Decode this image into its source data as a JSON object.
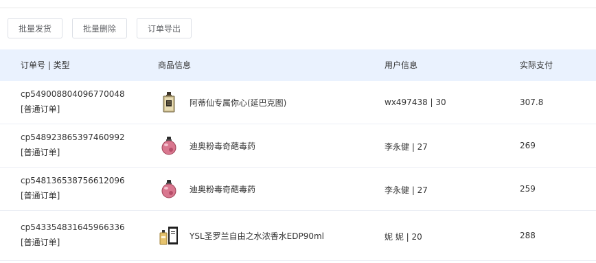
{
  "toolbar": {
    "batch_ship": "批量发货",
    "batch_delete": "批量删除",
    "export_orders": "订单导出"
  },
  "table": {
    "headers": {
      "order": "订单号 | 类型",
      "goods": "商品信息",
      "user": "用户信息",
      "pay": "实际支付"
    },
    "rows": [
      {
        "order_no": "cp549008804096770048",
        "type": "[普通订单]",
        "product": "阿蒂仙专属你心(延巴克图)",
        "product_icon": "perfume-bottle-gold-icon",
        "user": "wx497438 | 30",
        "pay": "307.8"
      },
      {
        "order_no": "cp548923865397460992",
        "type": "[普通订单]",
        "product": "迪奥粉毒奇葩毒药",
        "product_icon": "perfume-bottle-pink-icon",
        "user": "李永健 | 27",
        "pay": "269"
      },
      {
        "order_no": "cp548136538756612096",
        "type": "[普通订单]",
        "product": "迪奥粉毒奇葩毒药",
        "product_icon": "perfume-bottle-pink-icon",
        "user": "李永健 | 27",
        "pay": "259"
      },
      {
        "order_no": "cp543354831645966336",
        "type": "[普通订单]",
        "product": "YSL圣罗兰自由之水浓香水EDP90ml",
        "product_icon": "perfume-box-ysl-icon",
        "user": "妮 妮 | 20",
        "pay": "288"
      }
    ]
  }
}
